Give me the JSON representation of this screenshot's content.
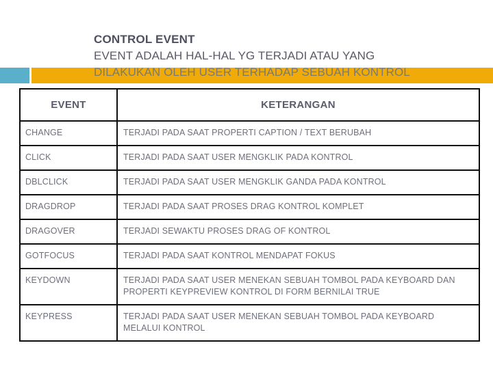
{
  "slide": {
    "title_lines": [
      "CONTROL EVENT",
      "EVENT ADALAH HAL-HAL YG TERJADI ATAU YANG",
      "DILAKUKAN OLEH USER TERHADAP SEBUAH KONTROL"
    ],
    "accent_colors": {
      "teal": "#5aafca",
      "orange": "#f0ab09",
      "title_text": "#595a68",
      "band_text": "#7a7a72",
      "table_border": "#0d0d0d",
      "table_text": "#6d6f7c"
    }
  },
  "table": {
    "headers": [
      "EVENT",
      "KETERANGAN"
    ],
    "rows": [
      {
        "event": "CHANGE",
        "keterangan": "TERJADI PADA SAAT PROPERTI CAPTION / TEXT BERUBAH"
      },
      {
        "event": "CLICK",
        "keterangan": "TERJADI PADA SAAT USER MENGKLIK PADA KONTROL"
      },
      {
        "event": "DBLCLICK",
        "keterangan": "TERJADI PADA SAAT USER MENGKLIK GANDA PADA KONTROL"
      },
      {
        "event": "DRAGDROP",
        "keterangan": "TERJADI PADA SAAT PROSES DRAG KONTROL KOMPLET"
      },
      {
        "event": "DRAGOVER",
        "keterangan": "TERJADI SEWAKTU PROSES DRAG OF KONTROL"
      },
      {
        "event": "GOTFOCUS",
        "keterangan": "TERJADI PADA SAAT KONTROL MENDAPAT FOKUS"
      },
      {
        "event": "KEYDOWN",
        "keterangan": "TERJADI PADA SAAT USER MENEKAN SEBUAH TOMBOL PADA KEYBOARD DAN PROPERTI KEYPREVIEW KONTROL DI FORM BERNILAI TRUE"
      },
      {
        "event": "KEYPRESS",
        "keterangan": "TERJADI PADA SAAT USER MENEKAN SEBUAH TOMBOL PADA KEYBOARD MELALUI KONTROL"
      }
    ]
  }
}
